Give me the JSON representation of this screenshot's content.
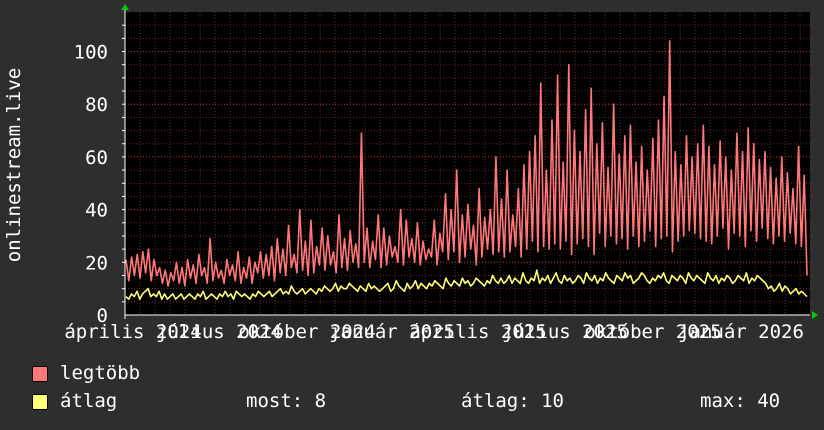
{
  "chart_data": {
    "type": "line",
    "ylabel": "onlinestream.live",
    "ylim": [
      0,
      115
    ],
    "yticks": [
      0,
      20,
      40,
      60,
      80,
      100
    ],
    "grid": true,
    "xticks": [
      "április 2024",
      "július 2024",
      "október 2024",
      "január 2025",
      "április 2025",
      "július 2025",
      "október 2025",
      "január 2026"
    ],
    "colors": {
      "background": "#2e2e2e",
      "plot": "#000000",
      "grid": "#6a2a2a",
      "axis": "#ffffff",
      "arrow": "#00cc00",
      "max": "#ff7777",
      "avg": "#ffff77"
    },
    "series": [
      {
        "name": "legtöbb",
        "color": "#ff7777",
        "values": [
          21,
          13,
          22,
          15,
          23,
          14,
          24,
          16,
          25,
          13,
          21,
          15,
          18,
          12,
          17,
          11,
          16,
          13,
          20,
          12,
          18,
          11,
          21,
          14,
          19,
          12,
          23,
          15,
          18,
          12,
          29,
          13,
          20,
          14,
          17,
          12,
          21,
          15,
          19,
          13,
          24,
          12,
          18,
          14,
          22,
          12,
          20,
          16,
          24,
          14,
          23,
          15,
          26,
          13,
          29,
          16,
          25,
          15,
          34,
          18,
          23,
          16,
          40,
          17,
          28,
          15,
          36,
          16,
          26,
          19,
          33,
          17,
          30,
          19,
          24,
          16,
          38,
          18,
          29,
          17,
          32,
          20,
          27,
          18,
          69,
          20,
          33,
          18,
          28,
          21,
          38,
          18,
          33,
          19,
          30,
          22,
          26,
          20,
          40,
          19,
          36,
          22,
          29,
          20,
          35,
          19,
          28,
          21,
          25,
          22,
          36,
          19,
          31,
          24,
          46,
          21,
          40,
          24,
          55,
          20,
          38,
          22,
          42,
          25,
          34,
          19,
          48,
          22,
          37,
          25,
          40,
          23,
          60,
          24,
          44,
          22,
          55,
          24,
          38,
          26,
          48,
          22,
          57,
          25,
          62,
          28,
          68,
          24,
          88,
          26,
          55,
          25,
          74,
          27,
          91,
          25,
          58,
          28,
          95,
          23,
          70,
          27,
          62,
          29,
          78,
          26,
          86,
          23,
          65,
          31,
          73,
          26,
          56,
          30,
          80,
          27,
          61,
          29,
          68,
          25,
          72,
          30,
          58,
          26,
          64,
          28,
          55,
          32,
          67,
          26,
          74,
          29,
          83,
          30,
          104,
          24,
          62,
          28,
          57,
          30,
          68,
          32,
          60,
          31,
          65,
          29,
          72,
          28,
          64,
          27,
          57,
          30,
          66,
          33,
          60,
          25,
          55,
          31,
          69,
          30,
          62,
          26,
          71,
          32,
          65,
          28,
          59,
          33,
          62,
          29,
          56,
          27,
          52,
          30,
          60,
          28,
          54,
          31,
          48,
          27,
          64,
          26,
          53,
          15
        ]
      },
      {
        "name": "átlag",
        "color": "#ffff77",
        "values": [
          7,
          6,
          8,
          7,
          9,
          6,
          8,
          9,
          10,
          7,
          8,
          7,
          9,
          6,
          8,
          6,
          7,
          8,
          6,
          7,
          8,
          6,
          7,
          8,
          7,
          6,
          8,
          7,
          9,
          6,
          7,
          8,
          7,
          6,
          8,
          7,
          9,
          7,
          8,
          6,
          9,
          8,
          7,
          8,
          7,
          6,
          8,
          7,
          9,
          8,
          7,
          8,
          9,
          7,
          8,
          9,
          10,
          8,
          9,
          8,
          11,
          9,
          8,
          9,
          10,
          8,
          9,
          10,
          9,
          8,
          10,
          9,
          11,
          10,
          9,
          10,
          12,
          9,
          11,
          10,
          10,
          12,
          11,
          10,
          9,
          11,
          10,
          9,
          12,
          10,
          11,
          10,
          9,
          10,
          11,
          12,
          9,
          10,
          13,
          11,
          10,
          9,
          12,
          10,
          11,
          13,
          10,
          12,
          11,
          10,
          12,
          11,
          13,
          12,
          11,
          10,
          14,
          12,
          11,
          13,
          12,
          11,
          14,
          12,
          13,
          11,
          12,
          14,
          13,
          12,
          11,
          13,
          12,
          15,
          13,
          12,
          14,
          12,
          13,
          15,
          12,
          14,
          13,
          12,
          16,
          13,
          12,
          14,
          13,
          17,
          12,
          14,
          13,
          15,
          12,
          14,
          16,
          13,
          12,
          15,
          13,
          14,
          12,
          13,
          15,
          14,
          12,
          16,
          14,
          13,
          15,
          12,
          14,
          13,
          16,
          14,
          13,
          12,
          15,
          14,
          13,
          16,
          14,
          15,
          12,
          13,
          14,
          16,
          15,
          13,
          12,
          14,
          13,
          15,
          14,
          16,
          13,
          12,
          15,
          14,
          13,
          15,
          14,
          12,
          16,
          14,
          13,
          15,
          14,
          13,
          12,
          16,
          14,
          13,
          15,
          12,
          14,
          13,
          15,
          14,
          12,
          13,
          15,
          14,
          13,
          16,
          12,
          14,
          13,
          15,
          14,
          13,
          12,
          10,
          11,
          9,
          10,
          12,
          9,
          11,
          10,
          8,
          9,
          10,
          8,
          9,
          8,
          7
        ]
      }
    ]
  },
  "legend": [
    {
      "label": "legtöbb",
      "color": "#ff7777"
    },
    {
      "label": "átlag",
      "color": "#ffff77"
    }
  ],
  "stats": {
    "now": "most: 8",
    "avg": "átlag: 10",
    "max": "max: 40"
  }
}
